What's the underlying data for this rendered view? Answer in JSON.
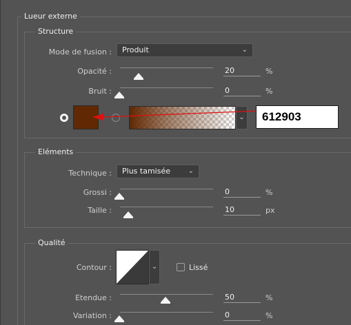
{
  "panel": {
    "group_title": "Lueur externe",
    "structure": {
      "legend": "Structure",
      "blend_mode": {
        "label": "Mode de fusion :",
        "value": "Produit"
      },
      "opacity": {
        "label": "Opacité :",
        "value": "20",
        "unit": "%",
        "level_percent": 20
      },
      "noise": {
        "label": "Bruit :",
        "value": "0",
        "unit": "%",
        "level_percent": 0
      },
      "color": {
        "hex_annotation": "612903",
        "swatch_color": "#612903",
        "annotation_arrow_color": "#e01010"
      }
    },
    "elements": {
      "legend": "Eléments",
      "technique": {
        "label": "Technique :",
        "value": "Plus tamisée"
      },
      "spread": {
        "label": "Grossi :",
        "value": "0",
        "unit": "%",
        "level_percent": 0
      },
      "size": {
        "label": "Taille :",
        "value": "10",
        "unit": "px",
        "level_percent": 8
      }
    },
    "quality": {
      "legend": "Qualité",
      "contour": {
        "label": "Contour :",
        "antialias_label": "Lissé",
        "antialias_checked": false
      },
      "range": {
        "label": "Etendue :",
        "value": "50",
        "unit": "%",
        "level_percent": 50
      },
      "jitter": {
        "label": "Variation :",
        "value": "0",
        "unit": "%",
        "level_percent": 0
      }
    }
  },
  "colors": {
    "background": "#535353",
    "field": "#3c3c3c",
    "text": "#e8e8e8"
  },
  "icons": [
    "radio-on-icon",
    "radio-off-icon",
    "chevron-down-icon",
    "checkbox-icon",
    "contour-curve-icon"
  ]
}
